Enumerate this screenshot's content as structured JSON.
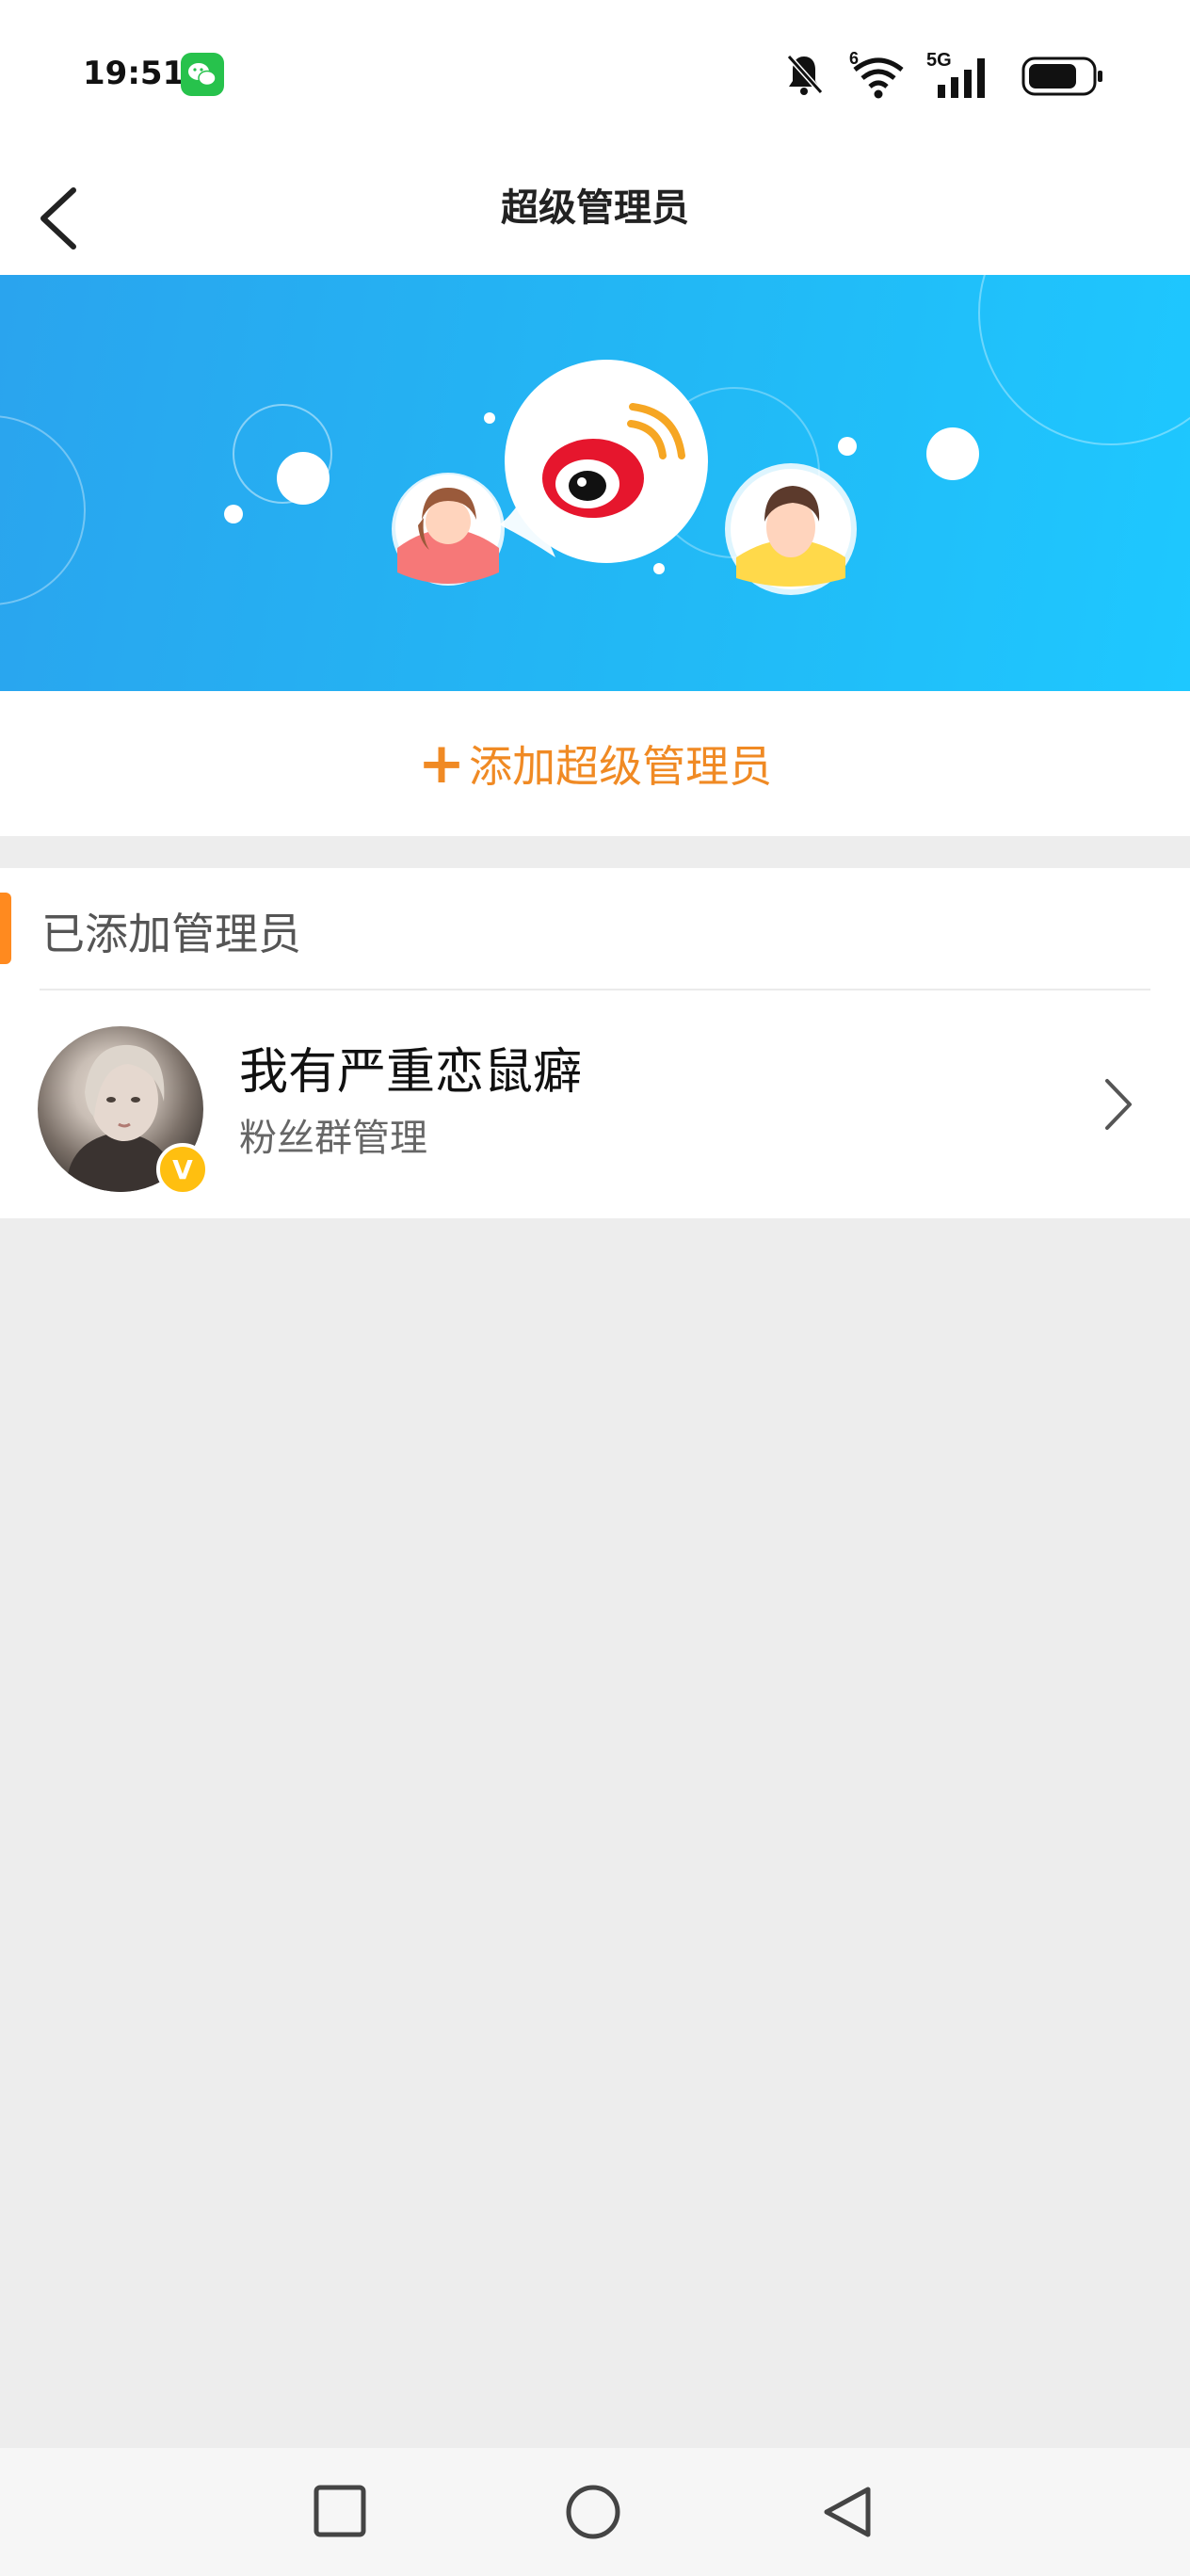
{
  "status_bar": {
    "time": "19:51",
    "icons": [
      "wechat-icon",
      "mute-icon",
      "wifi-icon",
      "signal-icon",
      "battery-icon"
    ],
    "wifi_label": "6",
    "network_label": "5G"
  },
  "header": {
    "title": "超级管理员",
    "back_icon": "chevron-left-icon"
  },
  "banner": {
    "illustration": "weibo-logo-with-avatars"
  },
  "add_admin": {
    "plus": "+",
    "label": "添加超级管理员",
    "color": "#f08a24"
  },
  "admins_section": {
    "title": "已添加管理员",
    "accent_color": "#ff8a1f",
    "items": [
      {
        "name": "我有严重恋鼠癖",
        "role": "粉丝群管理",
        "badge": "V"
      }
    ]
  },
  "system_nav": {
    "buttons": [
      "recent-apps",
      "home",
      "back"
    ]
  }
}
